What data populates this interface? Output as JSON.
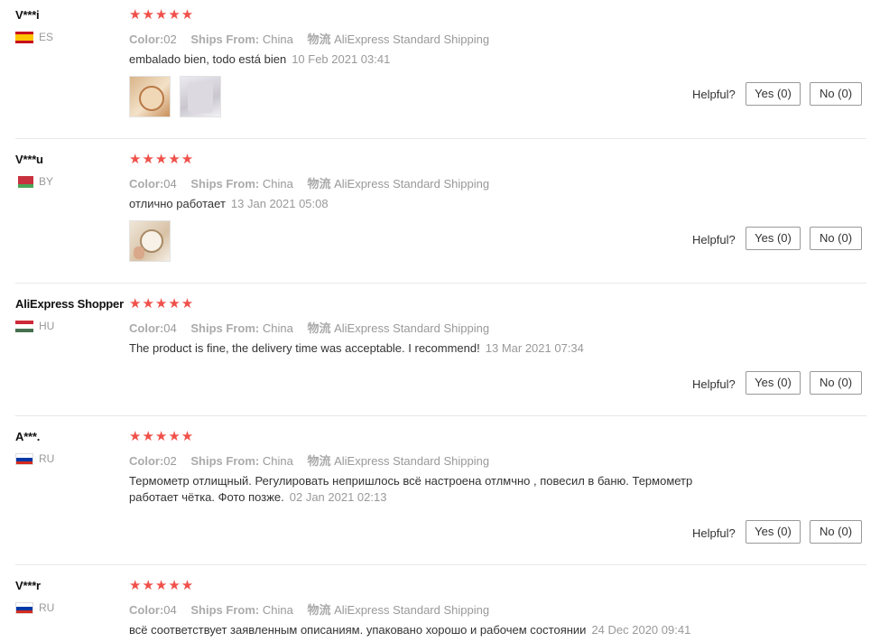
{
  "labels": {
    "color": "Color:",
    "ships_from": "Ships From:",
    "shipping_label": "物流",
    "helpful": "Helpful?"
  },
  "reviews": [
    {
      "user": "V***i",
      "country": "ES",
      "flag_colors": [
        "#c60b1e",
        "#ffc400",
        "#c60b1e"
      ],
      "stars": "★★★★★",
      "color": "02",
      "ships_from": "China",
      "shipping": "AliExpress Standard Shipping",
      "text": "embalado bien, todo está bien",
      "date": "10 Feb 2021 03:41",
      "yes": "Yes (0)",
      "no": "No (0)"
    },
    {
      "user": "V***u",
      "country": "BY",
      "flag_colors": [
        "#c8313e",
        "#c8313e",
        "#4aa657"
      ],
      "stars": "★★★★★",
      "color": "04",
      "ships_from": "China",
      "shipping": "AliExpress Standard Shipping",
      "text": "отлично работает",
      "date": "13 Jan 2021 05:08",
      "yes": "Yes (0)",
      "no": "No (0)"
    },
    {
      "user": "AliExpress Shopper",
      "country": "HU",
      "flag_colors": [
        "#ce2939",
        "#ffffff",
        "#477050"
      ],
      "stars": "★★★★★",
      "color": "04",
      "ships_from": "China",
      "shipping": "AliExpress Standard Shipping",
      "text": "The product is fine, the delivery time was acceptable. I recommend!",
      "date": "13 Mar 2021 07:34",
      "yes": "Yes (0)",
      "no": "No (0)"
    },
    {
      "user": "A***.",
      "country": "RU",
      "flag_colors": [
        "#ffffff",
        "#0039a6",
        "#d52b1e"
      ],
      "stars": "★★★★★",
      "color": "02",
      "ships_from": "China",
      "shipping": "AliExpress Standard Shipping",
      "text": "Термометр отлищный. Регулировать непришлось всё настроена отлмчно , повесил в баню. Термометр работает чётка. Фото позже.",
      "date": "02 Jan 2021 02:13",
      "yes": "Yes (0)",
      "no": "No (0)"
    },
    {
      "user": "V***r",
      "country": "RU",
      "flag_colors": [
        "#ffffff",
        "#0039a6",
        "#d52b1e"
      ],
      "stars": "★★★★★",
      "color": "04",
      "ships_from": "China",
      "shipping": "AliExpress Standard Shipping",
      "text": "всё соответствует заявленным описаниям. упаковано хорошо и рабочем состоянии",
      "date": "24 Dec 2020 09:41"
    }
  ]
}
